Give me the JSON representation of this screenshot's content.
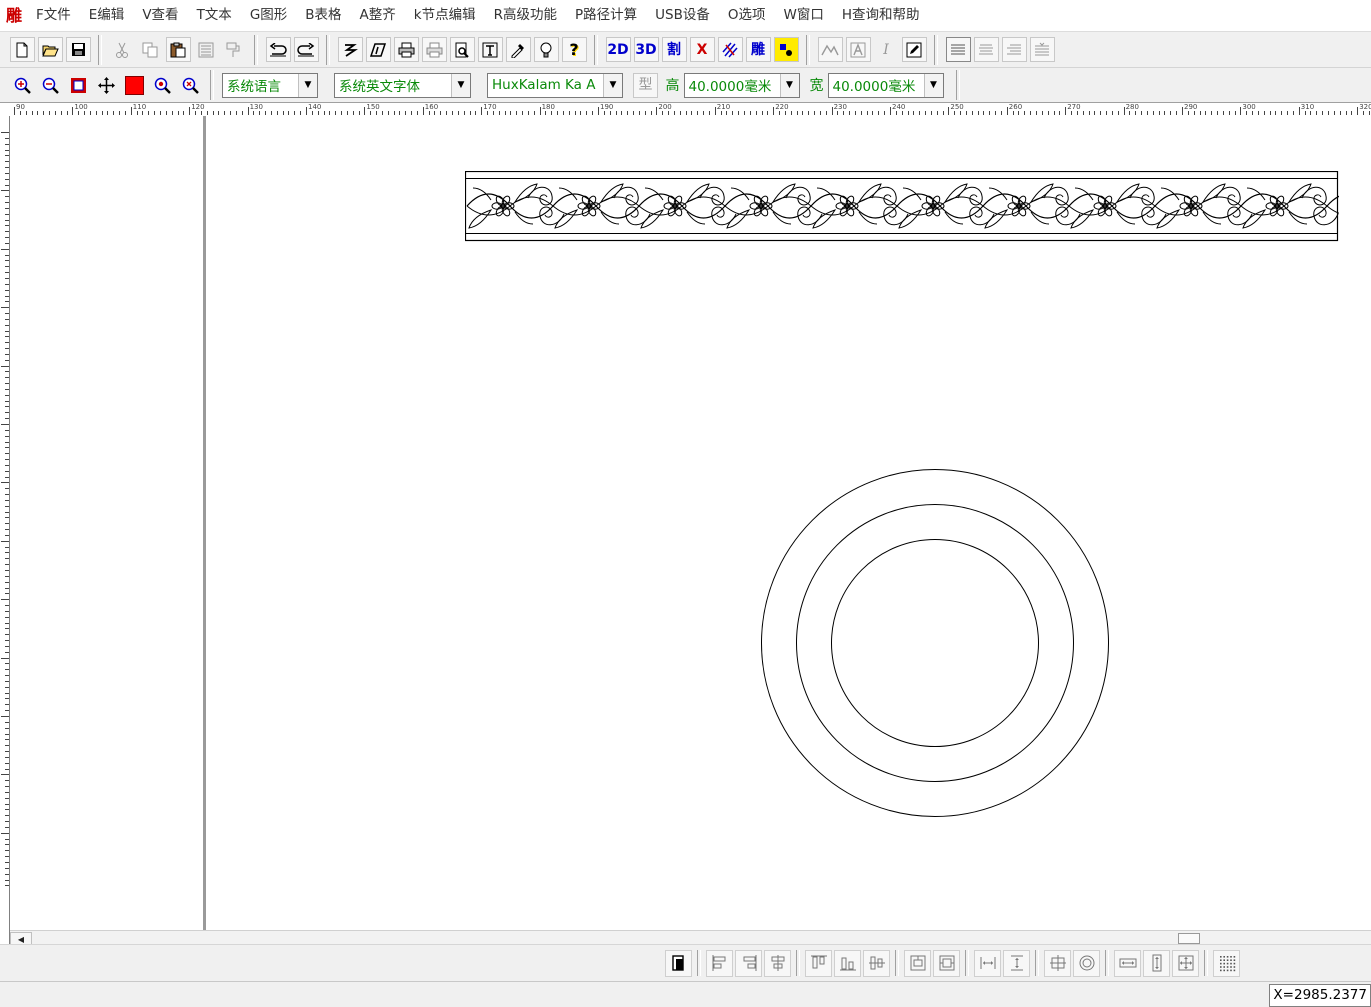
{
  "app": {
    "icon_char": "雕"
  },
  "menu": [
    "F文件",
    "E编辑",
    "V查看",
    "T文本",
    "G图形",
    "B表格",
    "A整齐",
    "k节点编辑",
    "R高级功能",
    "P路径计算",
    "USB设备",
    "O选项",
    "W窗口",
    "H查询和帮助"
  ],
  "toolbar": {
    "btn_2d": "2D",
    "btn_3d": "3D",
    "btn_cut": "割",
    "btn_carve": "雕",
    "btn_x": "X"
  },
  "format_bar": {
    "language_value": "系统语言",
    "en_font_value": "系统英文字体",
    "font_value": "HuxKalam Ka A",
    "type_label": "型",
    "height_label": "高",
    "height_value": "40.0000毫米",
    "width_label": "宽",
    "width_value": "40.0000毫米"
  },
  "ruler": {
    "top_labels": [
      "90",
      "100",
      "110",
      "120",
      "130",
      "140",
      "150",
      "160",
      "170",
      "180",
      "190",
      "200",
      "210",
      "220",
      "230",
      "240",
      "250",
      "260",
      "270",
      "280",
      "290",
      "300",
      "310",
      "320"
    ],
    "left_labels": [
      "",
      "",
      "",
      "",
      "",
      "",
      "",
      "",
      "",
      "",
      "",
      "",
      ""
    ]
  },
  "canvas": {
    "objects": [
      "floral-border-strip",
      "concentric-circles"
    ]
  },
  "statusbar": {
    "coord": "X=2985.2377"
  },
  "colors": {
    "menu_bg": "#ffffff",
    "toolbar_bg": "#f0f0f0",
    "combo_text": "#0a8a0a",
    "accent_blue": "#0000cc",
    "accent_red": "#cc0000",
    "highlight_yellow": "#ffeb00"
  }
}
